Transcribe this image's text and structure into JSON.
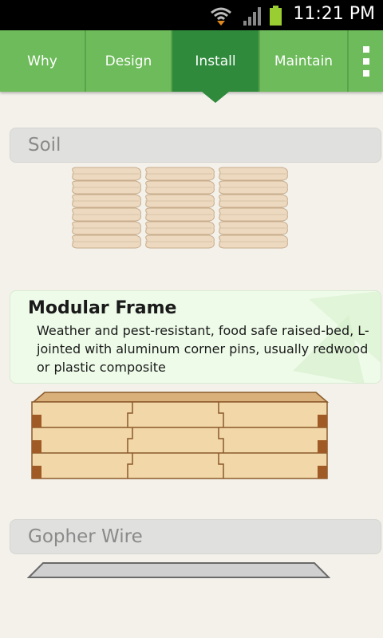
{
  "status_bar": {
    "time": "11:21 PM"
  },
  "tabs": [
    {
      "label": "Why",
      "active": false
    },
    {
      "label": "Design",
      "active": false
    },
    {
      "label": "Install",
      "active": true
    },
    {
      "label": "Maintain",
      "active": false
    }
  ],
  "sections": {
    "soil": {
      "header": "Soil"
    },
    "modular_frame": {
      "title": "Modular Frame",
      "description": "Weather and pest-resistant, food safe raised-bed, L-jointed with aluminum corner pins, usually redwood or plastic composite"
    },
    "gopher_wire": {
      "header": "Gopher Wire"
    }
  },
  "colors": {
    "tab_bar": "#6dbb5a",
    "tab_active": "#2f8a3c",
    "card_bg": "#eefbe9",
    "wood": "#f2d7a8"
  }
}
